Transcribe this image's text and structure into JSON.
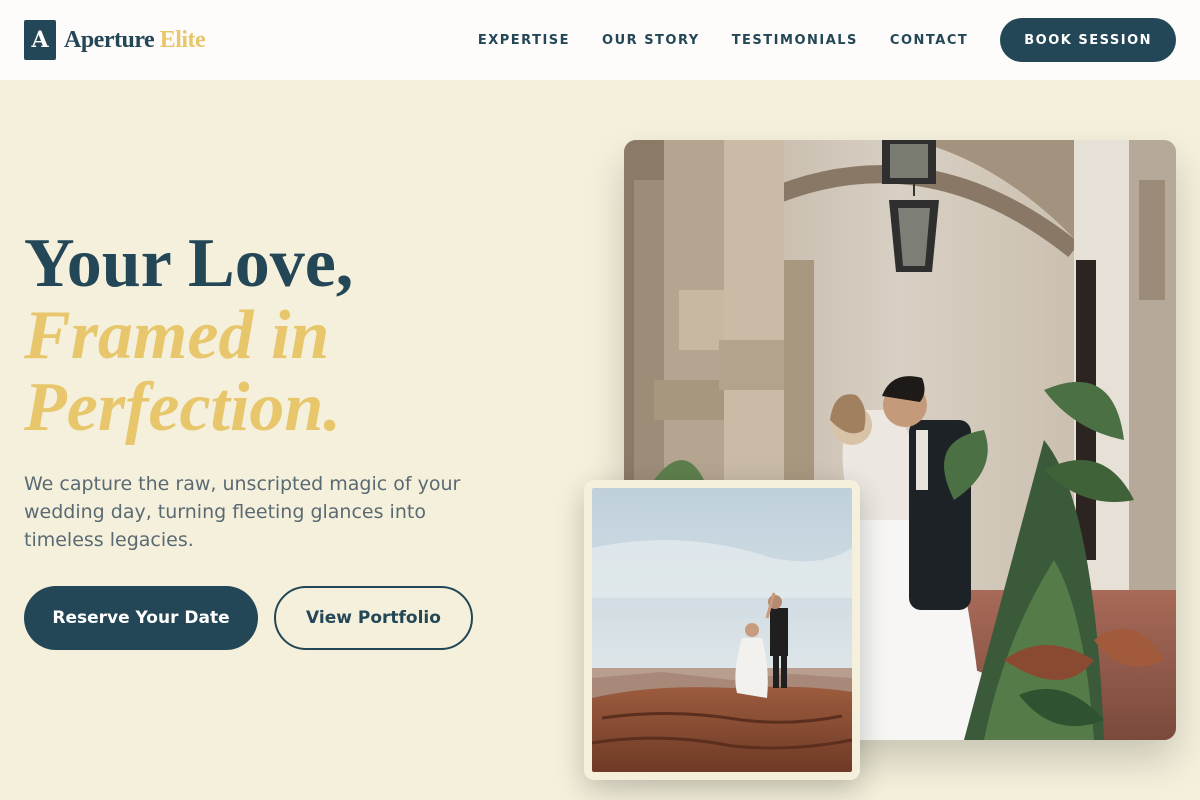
{
  "brand": {
    "mark": "A",
    "name_part1": "Aperture",
    "name_part2": "Elite"
  },
  "nav": {
    "links": [
      "EXPERTISE",
      "OUR STORY",
      "TESTIMONIALS",
      "CONTACT"
    ],
    "cta": "BOOK SESSION"
  },
  "hero": {
    "heading_line1": "Your Love,",
    "heading_line2": "Framed in",
    "heading_line3": "Perfection.",
    "subtitle": "We capture the raw, unscripted magic of your wedding day, turning fleeting glances into timeless legacies.",
    "primary_button": "Reserve Your Date",
    "secondary_button": "View Portfolio"
  },
  "colors": {
    "navy": "#234756",
    "gold": "#e8c66c",
    "cream": "#f5f0dc"
  }
}
